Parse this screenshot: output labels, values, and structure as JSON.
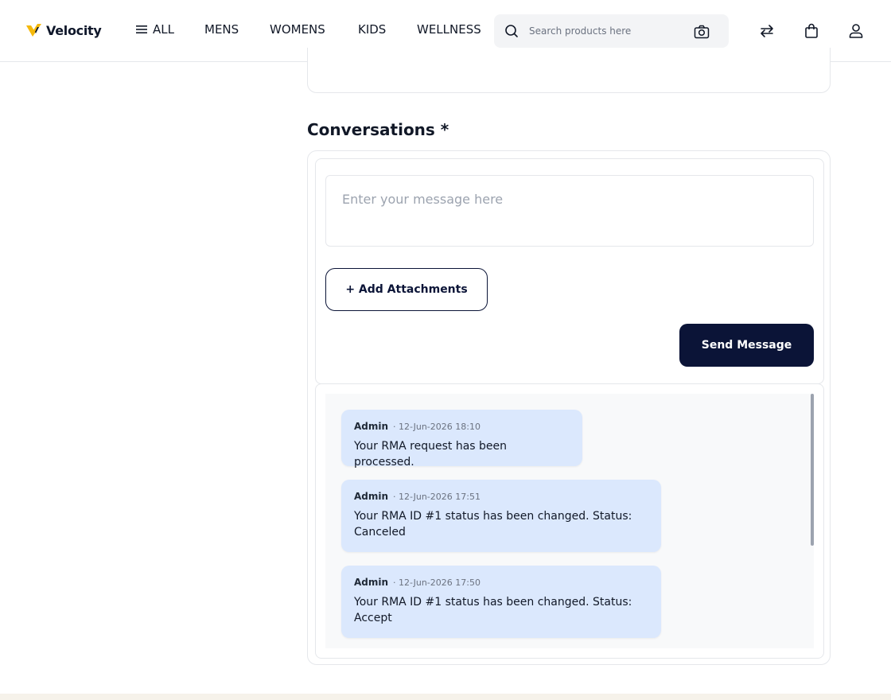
{
  "brand": {
    "name": "Velocity"
  },
  "nav": {
    "all_label": "ALL",
    "items": [
      "MENS",
      "WOMENS",
      "KIDS",
      "WELLNESS"
    ]
  },
  "search": {
    "placeholder": "Search products here"
  },
  "header_icons": [
    "search-icon",
    "camera-icon",
    "compare-icon",
    "bag-icon",
    "user-icon"
  ],
  "conversations": {
    "title": "Conversations *",
    "message_placeholder": "Enter your message here",
    "attach_label": "+ Add Attachments",
    "send_label": "Send Message",
    "messages": [
      {
        "author": "Admin",
        "time": "· 12-Jun-2026 18:10",
        "text": "Your RMA request has been processed."
      },
      {
        "author": "Admin",
        "time": "· 12-Jun-2026 17:51",
        "text": "Your RMA ID #1 status has been changed. Status: Canceled"
      },
      {
        "author": "Admin",
        "time": "· 12-Jun-2026 17:50",
        "text": "Your RMA ID #1 status has been changed. Status: Accept"
      }
    ]
  },
  "colors": {
    "primary": "#0b1437",
    "bubble": "#dbe8fd",
    "logo_yellow": "#f5b90b",
    "footer": "#f6f2ea"
  }
}
